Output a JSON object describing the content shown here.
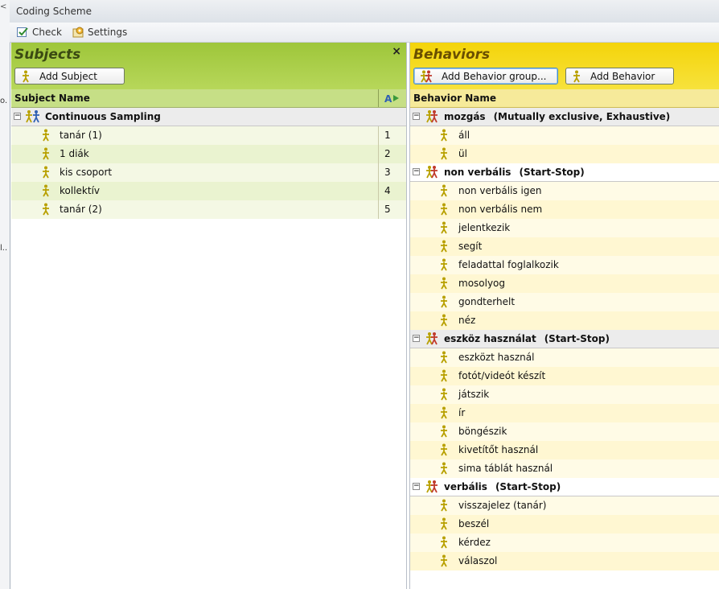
{
  "window": {
    "title": "Coding Scheme"
  },
  "left_sliver": {
    "chevron": "<",
    "text1": "o.",
    "text2": "l.."
  },
  "toolbar": {
    "check_label": "Check",
    "settings_label": "Settings",
    "check_icon": "check-icon",
    "settings_icon": "settings-icon"
  },
  "subjects": {
    "title": "Subjects",
    "close": "×",
    "add_button": "Add Subject",
    "column_header": "Subject Name",
    "sort_icon": "sort-icon",
    "group": {
      "name": "Continuous Sampling",
      "expanded_symbol": "−"
    },
    "items": [
      {
        "name": "tanár (1)",
        "number": "1"
      },
      {
        "name": "1 diák",
        "number": "2"
      },
      {
        "name": "kis csoport",
        "number": "3"
      },
      {
        "name": "kollektív",
        "number": "4"
      },
      {
        "name": "tanár (2)",
        "number": "5"
      }
    ]
  },
  "behaviors": {
    "title": "Behaviors",
    "add_group_button": "Add Behavior group...",
    "add_button": "Add Behavior",
    "column_header": "Behavior Name",
    "groups": [
      {
        "name": "mozgás",
        "type": "(Mutually exclusive, Exhaustive)",
        "expanded_symbol": "−",
        "items": [
          "áll",
          "ül"
        ]
      },
      {
        "name": "non verbális",
        "type": "(Start-Stop)",
        "expanded_symbol": "−",
        "items": [
          "non verbális igen",
          "non verbális nem",
          "jelentkezik",
          "segít",
          "feladattal foglalkozik",
          "mosolyog",
          "gondterhelt",
          "néz"
        ]
      },
      {
        "name": "eszköz használat",
        "type": "(Start-Stop)",
        "expanded_symbol": "−",
        "items": [
          "eszközt használ",
          "fotót/videót készít",
          "játszik",
          "ír",
          "böngészik",
          "kivetítőt használ",
          "sima táblát használ"
        ]
      },
      {
        "name": "verbális",
        "type": "(Start-Stop)",
        "expanded_symbol": "−",
        "items": [
          "visszajelez (tanár)",
          "beszél",
          "kérdez",
          "válaszol"
        ]
      }
    ]
  },
  "colors": {
    "subjects_accent": "#9ec63a",
    "behaviors_accent": "#f4d40a",
    "person_icon": "#b8a000",
    "group_icon_red": "#c0392b",
    "group_icon_blue": "#2f5fb3"
  }
}
